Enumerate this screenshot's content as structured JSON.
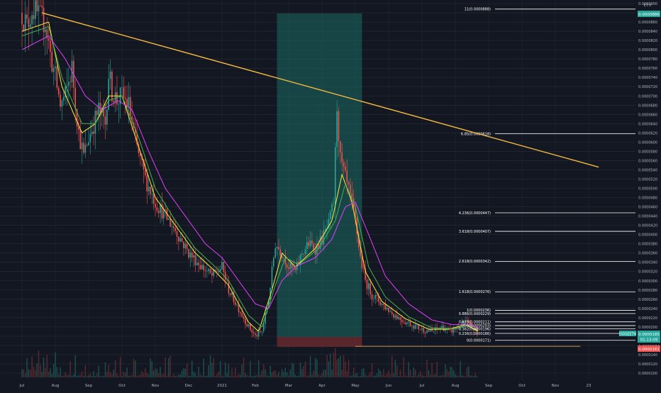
{
  "chart_data": {
    "type": "candlestick",
    "title": "",
    "currency_label": "ETH",
    "symbol_tag": "DOGEETH",
    "current_price": "0.0000185",
    "countdown": "01:13:09",
    "price_tag_teal": "0.0000886",
    "price_tag_low1": "0.0000174",
    "price_tag_low2": "0.0000161",
    "ylim": [
      1e-05,
      9e-05
    ],
    "y_ticks": [
      "0.0000900",
      "0.0000880",
      "0.0000860",
      "0.0000840",
      "0.0000820",
      "0.0000800",
      "0.0000780",
      "0.0000760",
      "0.0000740",
      "0.0000720",
      "0.0000700",
      "0.0000680",
      "0.0000660",
      "0.0000640",
      "0.0000620",
      "0.0000600",
      "0.0000580",
      "0.0000560",
      "0.0000540",
      "0.0000520",
      "0.0000500",
      "0.0000480",
      "0.0000460",
      "0.0000440",
      "0.0000420",
      "0.0000400",
      "0.0000380",
      "0.0000360",
      "0.0000340",
      "0.0000320",
      "0.0000300",
      "0.0000280",
      "0.0000260",
      "0.0000240",
      "0.0000220",
      "0.0000200",
      "0.0000180",
      "0.0000160",
      "0.0000140",
      "0.0000120",
      "0.0000100"
    ],
    "x_ticks": [
      "Jul",
      "Aug",
      "Sep",
      "Oct",
      "Nov",
      "Dec",
      "2021",
      "Feb",
      "Mar",
      "Apr",
      "May",
      "Jun",
      "Jul",
      "Aug",
      "Sep",
      "Oct",
      "Nov",
      "23"
    ],
    "x_tick_months": [
      0,
      1,
      2,
      3,
      4,
      5,
      6,
      7,
      8,
      9,
      10,
      11,
      12,
      13,
      14,
      15,
      16,
      17
    ],
    "fib_levels": [
      {
        "label": "11(0.0000888)",
        "value": 8.88e-05
      },
      {
        "label": "6.85(0.0000618)",
        "value": 6.18e-05
      },
      {
        "label": "4.236(0.0000447)",
        "value": 4.47e-05
      },
      {
        "label": "3.618(0.0000407)",
        "value": 4.07e-05
      },
      {
        "label": "2.618(0.0000342)",
        "value": 3.42e-05
      },
      {
        "label": "1.618(0.0000276)",
        "value": 2.76e-05
      },
      {
        "label": "1(0.0000236)",
        "value": 2.36e-05
      },
      {
        "label": "0.886(0.0000229)",
        "value": 2.29e-05
      },
      {
        "label": "0.618(0.0000211)",
        "value": 2.11e-05
      },
      {
        "label": "0.5(0.0000203)",
        "value": 2.03e-05
      },
      {
        "label": "0.382(0.0000196)",
        "value": 1.96e-05
      },
      {
        "label": "0.236(0.0000186)",
        "value": 1.86e-05
      },
      {
        "label": "0(0.0000171)",
        "value": 1.71e-05
      }
    ],
    "price_path": [
      [
        0.0,
        8.8e-05
      ],
      [
        0.15,
        8.5e-05
      ],
      [
        0.3,
        8.9e-05
      ],
      [
        0.5,
        8.7e-05
      ],
      [
        0.7,
        8.6e-05
      ],
      [
        0.85,
        7.9e-05
      ],
      [
        1.0,
        7.4e-05
      ],
      [
        1.15,
        6.8e-05
      ],
      [
        1.3,
        7e-05
      ],
      [
        1.5,
        7.6e-05
      ],
      [
        1.7,
        6.2e-05
      ],
      [
        1.85,
        5.7e-05
      ],
      [
        2.0,
        6.1e-05
      ],
      [
        2.15,
        6.4e-05
      ],
      [
        2.3,
        6.7e-05
      ],
      [
        2.5,
        6.4e-05
      ],
      [
        2.6,
        7.5e-05
      ],
      [
        2.7,
        7.1e-05
      ],
      [
        2.85,
        6.9e-05
      ],
      [
        3.0,
        7e-05
      ],
      [
        3.2,
        6.8e-05
      ],
      [
        3.4,
        6e-05
      ],
      [
        3.7,
        5.2e-05
      ],
      [
        4.0,
        4.7e-05
      ],
      [
        4.3,
        4.4e-05
      ],
      [
        4.6,
        4.1e-05
      ],
      [
        5.0,
        3.6e-05
      ],
      [
        5.4,
        3.3e-05
      ],
      [
        5.7,
        3.1e-05
      ],
      [
        6.0,
        3.3e-05
      ],
      [
        6.2,
        2.8e-05
      ],
      [
        6.5,
        2.4e-05
      ],
      [
        6.8,
        2e-05
      ],
      [
        7.0,
        1.8e-05
      ],
      [
        7.2,
        1.9e-05
      ],
      [
        7.4,
        2.6e-05
      ],
      [
        7.6,
        3.8e-05
      ],
      [
        7.8,
        3.6e-05
      ],
      [
        8.0,
        3.3e-05
      ],
      [
        8.2,
        3.2e-05
      ],
      [
        8.4,
        3.6e-05
      ],
      [
        8.6,
        3.8e-05
      ],
      [
        8.8,
        3.7e-05
      ],
      [
        9.0,
        3.9e-05
      ],
      [
        9.2,
        4.2e-05
      ],
      [
        9.35,
        4.7e-05
      ],
      [
        9.45,
        6.8e-05
      ],
      [
        9.55,
        5.6e-05
      ],
      [
        9.7,
        5.2e-05
      ],
      [
        9.85,
        4.8e-05
      ],
      [
        10.0,
        4.3e-05
      ],
      [
        10.15,
        3.5e-05
      ],
      [
        10.3,
        3e-05
      ],
      [
        10.5,
        2.7e-05
      ],
      [
        10.8,
        2.5e-05
      ],
      [
        11.1,
        2.3e-05
      ],
      [
        11.4,
        2.15e-05
      ],
      [
        11.7,
        2.05e-05
      ],
      [
        12.0,
        1.95e-05
      ],
      [
        12.3,
        1.9e-05
      ],
      [
        12.6,
        2e-05
      ],
      [
        12.85,
        1.9e-05
      ],
      [
        13.1,
        2e-05
      ],
      [
        13.3,
        2.1e-05
      ],
      [
        13.5,
        2e-05
      ],
      [
        13.7,
        1.85e-05
      ]
    ],
    "series": [
      {
        "color": "#ffeb3b",
        "values_path": [
          [
            0.0,
            8.4e-05
          ],
          [
            0.8,
            8.6e-05
          ],
          [
            1.2,
            7.2e-05
          ],
          [
            1.8,
            6.2e-05
          ],
          [
            2.2,
            6.4e-05
          ],
          [
            2.6,
            7e-05
          ],
          [
            3.0,
            7e-05
          ],
          [
            3.5,
            5.9e-05
          ],
          [
            4.0,
            4.8e-05
          ],
          [
            4.6,
            4.2e-05
          ],
          [
            5.2,
            3.6e-05
          ],
          [
            5.8,
            3.2e-05
          ],
          [
            6.2,
            2.9e-05
          ],
          [
            6.8,
            2.1e-05
          ],
          [
            7.1,
            1.9e-05
          ],
          [
            7.5,
            2.8e-05
          ],
          [
            7.8,
            3.6e-05
          ],
          [
            8.2,
            3.3e-05
          ],
          [
            8.8,
            3.7e-05
          ],
          [
            9.3,
            4.3e-05
          ],
          [
            9.6,
            5.3e-05
          ],
          [
            9.9,
            4.7e-05
          ],
          [
            10.3,
            3.2e-05
          ],
          [
            10.8,
            2.55e-05
          ],
          [
            11.5,
            2.18e-05
          ],
          [
            12.2,
            1.95e-05
          ],
          [
            12.8,
            1.95e-05
          ],
          [
            13.3,
            2.05e-05
          ],
          [
            13.7,
            1.9e-05
          ]
        ]
      },
      {
        "color": "#4caf50",
        "values_path": [
          [
            0.0,
            8.3e-05
          ],
          [
            0.8,
            8.5e-05
          ],
          [
            1.2,
            7.4e-05
          ],
          [
            1.8,
            6.4e-05
          ],
          [
            2.2,
            6.4e-05
          ],
          [
            2.6,
            6.9e-05
          ],
          [
            3.0,
            7e-05
          ],
          [
            3.5,
            6.1e-05
          ],
          [
            4.0,
            5e-05
          ],
          [
            4.6,
            4.3e-05
          ],
          [
            5.2,
            3.7e-05
          ],
          [
            5.8,
            3.3e-05
          ],
          [
            6.2,
            3e-05
          ],
          [
            6.8,
            2.25e-05
          ],
          [
            7.2,
            2e-05
          ],
          [
            7.6,
            2.9e-05
          ],
          [
            7.9,
            3.5e-05
          ],
          [
            8.3,
            3.35e-05
          ],
          [
            8.9,
            3.7e-05
          ],
          [
            9.4,
            4.3e-05
          ],
          [
            9.7,
            5.1e-05
          ],
          [
            10.0,
            4.6e-05
          ],
          [
            10.4,
            3.3e-05
          ],
          [
            10.9,
            2.65e-05
          ],
          [
            11.6,
            2.22e-05
          ],
          [
            12.3,
            1.98e-05
          ],
          [
            12.9,
            1.96e-05
          ],
          [
            13.4,
            2.03e-05
          ],
          [
            13.7,
            1.92e-05
          ]
        ]
      },
      {
        "color": "#e040fb",
        "values_path": [
          [
            0.0,
            8e-05
          ],
          [
            0.8,
            8.3e-05
          ],
          [
            1.3,
            7.8e-05
          ],
          [
            1.9,
            7e-05
          ],
          [
            2.4,
            6.7e-05
          ],
          [
            2.9,
            6.9e-05
          ],
          [
            3.3,
            6.7e-05
          ],
          [
            3.8,
            5.8e-05
          ],
          [
            4.3,
            5e-05
          ],
          [
            4.9,
            4.4e-05
          ],
          [
            5.5,
            3.8e-05
          ],
          [
            6.0,
            3.5e-05
          ],
          [
            6.5,
            3e-05
          ],
          [
            7.0,
            2.5e-05
          ],
          [
            7.4,
            2.4e-05
          ],
          [
            7.8,
            3e-05
          ],
          [
            8.2,
            3.3e-05
          ],
          [
            8.8,
            3.5e-05
          ],
          [
            9.3,
            3.9e-05
          ],
          [
            9.7,
            4.6e-05
          ],
          [
            10.0,
            4.7e-05
          ],
          [
            10.4,
            4e-05
          ],
          [
            10.9,
            3.1e-05
          ],
          [
            11.6,
            2.5e-05
          ],
          [
            12.3,
            2.15e-05
          ],
          [
            12.9,
            2.05e-05
          ],
          [
            13.4,
            2.05e-05
          ],
          [
            13.7,
            1.98e-05
          ]
        ]
      }
    ],
    "trendline": {
      "color": "#f5b840",
      "from": [
        0.6,
        8.8e-05
      ],
      "to": [
        17.3,
        5.46e-05
      ]
    },
    "highlight_zone": {
      "from_month": 7.65,
      "to_month": 10.2,
      "color": "#1b6b63"
    },
    "horizontal_support": {
      "from_month": 10.0,
      "to_month": 16.75,
      "value": 1.58e-05
    },
    "colors": {
      "up": "#26a69a",
      "down": "#ef5350",
      "grid": "#2a2e39",
      "axis_text": "#b2b5be",
      "teal_tag": "#26a69a",
      "red_tag": "#ef5350",
      "fib": "#ffffff"
    }
  }
}
